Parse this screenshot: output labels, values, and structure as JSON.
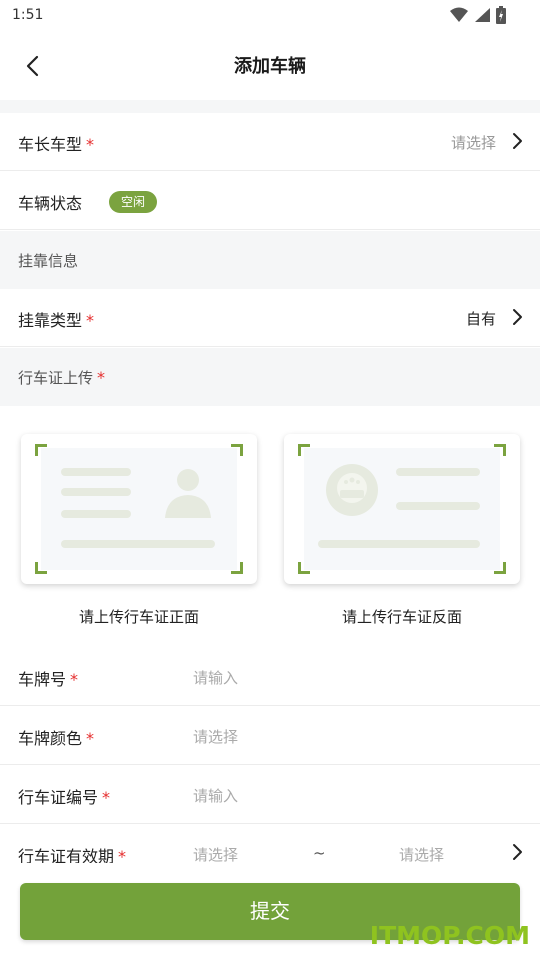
{
  "status_bar": {
    "time": "1:51",
    "icons": [
      "wifi-icon",
      "signal-icon",
      "battery-icon"
    ]
  },
  "header": {
    "title": "添加车辆",
    "back_icon": "chevron-left-icon"
  },
  "vehicle_type": {
    "label": "车长车型",
    "required": "*",
    "value": "请选择"
  },
  "vehicle_status": {
    "label": "车辆状态",
    "badge": "空闲"
  },
  "affiliation_section": {
    "label": "挂靠信息"
  },
  "affiliation_type": {
    "label": "挂靠类型",
    "required": "*",
    "value": "自有"
  },
  "license_upload_section": {
    "label": "行车证上传",
    "required": "*"
  },
  "upload_cards": {
    "front_caption": "请上传行车证正面",
    "back_caption": "请上传行车证反面"
  },
  "form": {
    "plate_number": {
      "label": "车牌号",
      "required": "*",
      "placeholder": "请输入"
    },
    "plate_color": {
      "label": "车牌颜色",
      "required": "*",
      "placeholder": "请选择"
    },
    "license_number": {
      "label": "行车证编号",
      "required": "*",
      "placeholder": "请输入"
    },
    "license_validity": {
      "label": "行车证有效期",
      "required": "*",
      "start_placeholder": "请选择",
      "separator": "~",
      "end_placeholder": "请选择"
    }
  },
  "submit": {
    "label": "提交"
  },
  "watermark": "ITMOP.COM",
  "colors": {
    "accent": "#73a23a",
    "required": "#e52d2d",
    "background": "#f5f6f7",
    "watermark": "#8fc31f"
  }
}
